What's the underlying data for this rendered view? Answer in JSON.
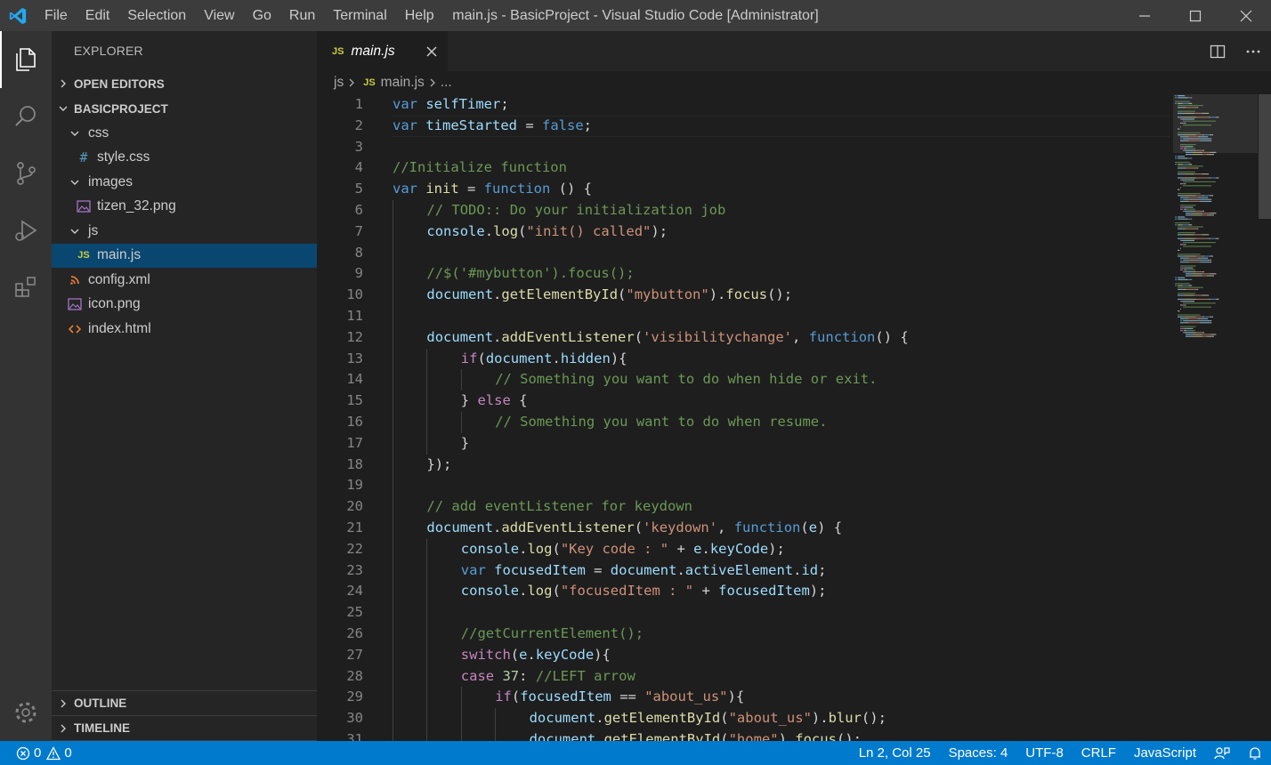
{
  "titlebar": {
    "menu": [
      "File",
      "Edit",
      "Selection",
      "View",
      "Go",
      "Run",
      "Terminal",
      "Help"
    ],
    "window_title": "main.js - BasicProject - Visual Studio Code [Administrator]"
  },
  "sidebar": {
    "title": "EXPLORER",
    "open_editors": "OPEN EDITORS",
    "project": "BASICPROJECT",
    "tree": [
      {
        "label": "css",
        "type": "folder",
        "depth": 1
      },
      {
        "label": "style.css",
        "type": "css",
        "depth": 2
      },
      {
        "label": "images",
        "type": "folder",
        "depth": 1
      },
      {
        "label": "tizen_32.png",
        "type": "image",
        "depth": 2
      },
      {
        "label": "js",
        "type": "folder",
        "depth": 1
      },
      {
        "label": "main.js",
        "type": "js",
        "depth": 2,
        "selected": true
      },
      {
        "label": "config.xml",
        "type": "xml",
        "depth": 1
      },
      {
        "label": "icon.png",
        "type": "image",
        "depth": 1
      },
      {
        "label": "index.html",
        "type": "html",
        "depth": 1
      }
    ],
    "outline": "OUTLINE",
    "timeline": "TIMELINE"
  },
  "editor": {
    "tab_label": "main.js",
    "tab_badge": "JS",
    "breadcrumb": {
      "folder": "js",
      "badge": "JS",
      "file": "main.js",
      "more": "..."
    },
    "current_line": 2
  },
  "code_lines": [
    {
      "n": "1",
      "indent": 0,
      "tokens": [
        [
          "k",
          "var"
        ],
        [
          "p",
          " "
        ],
        [
          "v",
          "selfTimer"
        ],
        [
          "p",
          ";"
        ]
      ]
    },
    {
      "n": "2",
      "indent": 0,
      "tokens": [
        [
          "k",
          "var"
        ],
        [
          "p",
          " "
        ],
        [
          "v",
          "timeStarted"
        ],
        [
          "p",
          " = "
        ],
        [
          "k",
          "false"
        ],
        [
          "p",
          ";"
        ]
      ]
    },
    {
      "n": "3",
      "indent": 0,
      "tokens": []
    },
    {
      "n": "4",
      "indent": 0,
      "tokens": [
        [
          "c",
          "//Initialize function"
        ]
      ]
    },
    {
      "n": "5",
      "indent": 0,
      "tokens": [
        [
          "k",
          "var"
        ],
        [
          "p",
          " "
        ],
        [
          "f",
          "init"
        ],
        [
          "p",
          " = "
        ],
        [
          "k",
          "function"
        ],
        [
          "p",
          " () {"
        ]
      ]
    },
    {
      "n": "6",
      "indent": 1,
      "tokens": [
        [
          "c",
          "// TODO:: Do your initialization job"
        ]
      ]
    },
    {
      "n": "7",
      "indent": 1,
      "tokens": [
        [
          "v",
          "console"
        ],
        [
          "p",
          "."
        ],
        [
          "f",
          "log"
        ],
        [
          "p",
          "("
        ],
        [
          "s",
          "\"init() called\""
        ],
        [
          "p",
          ");"
        ]
      ]
    },
    {
      "n": "8",
      "indent": 1,
      "tokens": []
    },
    {
      "n": "9",
      "indent": 1,
      "tokens": [
        [
          "c",
          "//$('#mybutton').focus();"
        ]
      ]
    },
    {
      "n": "10",
      "indent": 1,
      "tokens": [
        [
          "v",
          "document"
        ],
        [
          "p",
          "."
        ],
        [
          "f",
          "getElementById"
        ],
        [
          "p",
          "("
        ],
        [
          "s",
          "\"mybutton\""
        ],
        [
          "p",
          ")."
        ],
        [
          "f",
          "focus"
        ],
        [
          "p",
          "();"
        ]
      ]
    },
    {
      "n": "11",
      "indent": 1,
      "tokens": []
    },
    {
      "n": "12",
      "indent": 1,
      "tokens": [
        [
          "v",
          "document"
        ],
        [
          "p",
          "."
        ],
        [
          "f",
          "addEventListener"
        ],
        [
          "p",
          "("
        ],
        [
          "s",
          "'visibilitychange'"
        ],
        [
          "p",
          ", "
        ],
        [
          "k",
          "function"
        ],
        [
          "p",
          "() {"
        ]
      ]
    },
    {
      "n": "13",
      "indent": 2,
      "tokens": [
        [
          "ctl",
          "if"
        ],
        [
          "p",
          "("
        ],
        [
          "v",
          "document"
        ],
        [
          "p",
          "."
        ],
        [
          "v",
          "hidden"
        ],
        [
          "p",
          "){"
        ]
      ]
    },
    {
      "n": "14",
      "indent": 3,
      "tokens": [
        [
          "c",
          "// Something you want to do when hide or exit."
        ]
      ]
    },
    {
      "n": "15",
      "indent": 2,
      "tokens": [
        [
          "p",
          "} "
        ],
        [
          "ctl",
          "else"
        ],
        [
          "p",
          " {"
        ]
      ]
    },
    {
      "n": "16",
      "indent": 3,
      "tokens": [
        [
          "c",
          "// Something you want to do when resume."
        ]
      ]
    },
    {
      "n": "17",
      "indent": 2,
      "tokens": [
        [
          "p",
          "}"
        ]
      ]
    },
    {
      "n": "18",
      "indent": 1,
      "tokens": [
        [
          "p",
          "});"
        ]
      ]
    },
    {
      "n": "19",
      "indent": 1,
      "tokens": []
    },
    {
      "n": "20",
      "indent": 1,
      "tokens": [
        [
          "c",
          "// add eventListener for keydown"
        ]
      ]
    },
    {
      "n": "21",
      "indent": 1,
      "tokens": [
        [
          "v",
          "document"
        ],
        [
          "p",
          "."
        ],
        [
          "f",
          "addEventListener"
        ],
        [
          "p",
          "("
        ],
        [
          "s",
          "'keydown'"
        ],
        [
          "p",
          ", "
        ],
        [
          "k",
          "function"
        ],
        [
          "p",
          "("
        ],
        [
          "v",
          "e"
        ],
        [
          "p",
          ") {"
        ]
      ]
    },
    {
      "n": "22",
      "indent": 2,
      "tokens": [
        [
          "v",
          "console"
        ],
        [
          "p",
          "."
        ],
        [
          "f",
          "log"
        ],
        [
          "p",
          "("
        ],
        [
          "s",
          "\"Key code : \""
        ],
        [
          "p",
          " + "
        ],
        [
          "v",
          "e"
        ],
        [
          "p",
          "."
        ],
        [
          "v",
          "keyCode"
        ],
        [
          "p",
          ");"
        ]
      ]
    },
    {
      "n": "23",
      "indent": 2,
      "tokens": [
        [
          "k",
          "var"
        ],
        [
          "p",
          " "
        ],
        [
          "v",
          "focusedItem"
        ],
        [
          "p",
          " = "
        ],
        [
          "v",
          "document"
        ],
        [
          "p",
          "."
        ],
        [
          "v",
          "activeElement"
        ],
        [
          "p",
          "."
        ],
        [
          "v",
          "id"
        ],
        [
          "p",
          ";"
        ]
      ]
    },
    {
      "n": "24",
      "indent": 2,
      "tokens": [
        [
          "v",
          "console"
        ],
        [
          "p",
          "."
        ],
        [
          "f",
          "log"
        ],
        [
          "p",
          "("
        ],
        [
          "s",
          "\"focusedItem : \""
        ],
        [
          "p",
          " + "
        ],
        [
          "v",
          "focusedItem"
        ],
        [
          "p",
          ");"
        ]
      ]
    },
    {
      "n": "25",
      "indent": 2,
      "tokens": []
    },
    {
      "n": "26",
      "indent": 2,
      "tokens": [
        [
          "c",
          "//getCurrentElement();"
        ]
      ]
    },
    {
      "n": "27",
      "indent": 2,
      "tokens": [
        [
          "ctl",
          "switch"
        ],
        [
          "p",
          "("
        ],
        [
          "v",
          "e"
        ],
        [
          "p",
          "."
        ],
        [
          "v",
          "keyCode"
        ],
        [
          "p",
          "){"
        ]
      ]
    },
    {
      "n": "28",
      "indent": 2,
      "tokens": [
        [
          "ctl",
          "case"
        ],
        [
          "p",
          " "
        ],
        [
          "n",
          "37"
        ],
        [
          "p",
          ": "
        ],
        [
          "c",
          "//LEFT arrow"
        ]
      ]
    },
    {
      "n": "29",
      "indent": 3,
      "tokens": [
        [
          "ctl",
          "if"
        ],
        [
          "p",
          "("
        ],
        [
          "v",
          "focusedItem"
        ],
        [
          "p",
          " == "
        ],
        [
          "s",
          "\"about_us\""
        ],
        [
          "p",
          "){"
        ]
      ]
    },
    {
      "n": "30",
      "indent": 4,
      "tokens": [
        [
          "v",
          "document"
        ],
        [
          "p",
          "."
        ],
        [
          "f",
          "getElementById"
        ],
        [
          "p",
          "("
        ],
        [
          "s",
          "\"about_us\""
        ],
        [
          "p",
          ")."
        ],
        [
          "f",
          "blur"
        ],
        [
          "p",
          "();"
        ]
      ]
    },
    {
      "n": "31",
      "indent": 4,
      "tokens": [
        [
          "v",
          "document"
        ],
        [
          "p",
          "."
        ],
        [
          "f",
          "getElementById"
        ],
        [
          "p",
          "("
        ],
        [
          "s",
          "\"home\""
        ],
        [
          "p",
          ")."
        ],
        [
          "f",
          "focus"
        ],
        [
          "p",
          "();"
        ]
      ]
    }
  ],
  "statusbar": {
    "errors": "0",
    "warnings": "0",
    "position": "Ln 2, Col 25",
    "spaces": "Spaces: 4",
    "encoding": "UTF-8",
    "eol": "CRLF",
    "language": "JavaScript"
  },
  "colors": {
    "accent": "#007acc",
    "selection": "#094771",
    "js_badge": "#cbcb41"
  }
}
